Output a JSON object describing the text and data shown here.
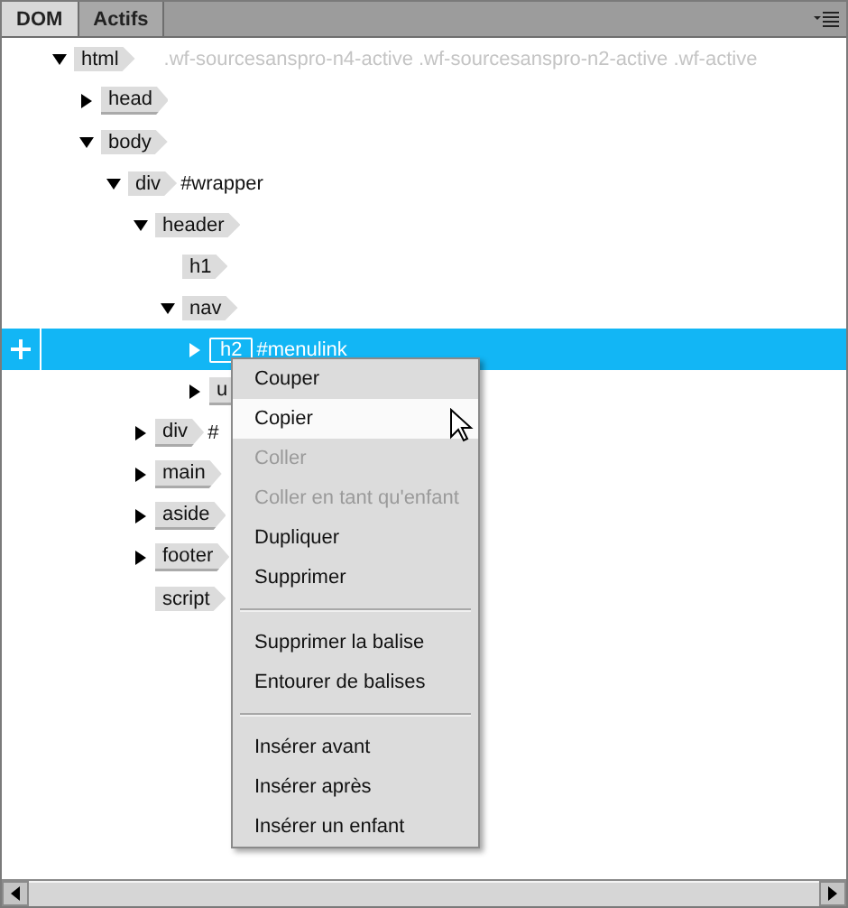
{
  "tabs": [
    {
      "label": "DOM",
      "selected": true
    },
    {
      "label": "Actifs",
      "selected": false
    }
  ],
  "tree": [
    {
      "tag": "html",
      "classes": ".wf-sourcesanspro-n4-active .wf-sourcesanspro-n2-active .wf-active",
      "expanded": true,
      "selected": false,
      "children": [
        {
          "tag": "head",
          "expanded": false,
          "selected": false
        },
        {
          "tag": "body",
          "expanded": true,
          "selected": false,
          "children": [
            {
              "tag": "div",
              "id": "#wrapper",
              "expanded": true,
              "selected": false,
              "children": [
                {
                  "tag": "header",
                  "expanded": true,
                  "selected": false,
                  "children": [
                    {
                      "tag": "h1",
                      "selected": false
                    },
                    {
                      "tag": "nav",
                      "expanded": true,
                      "selected": false,
                      "children": [
                        {
                          "tag": "h2",
                          "id": "#menulink",
                          "expanded": false,
                          "selected": true
                        },
                        {
                          "tag": "u",
                          "expanded": false,
                          "selected": false
                        }
                      ]
                    }
                  ]
                },
                {
                  "tag": "div",
                  "id": "#",
                  "expanded": false,
                  "selected": false
                },
                {
                  "tag": "main",
                  "expanded": false,
                  "selected": false
                },
                {
                  "tag": "aside",
                  "expanded": false,
                  "selected": false
                },
                {
                  "tag": "footer",
                  "expanded": false,
                  "selected": false
                },
                {
                  "tag": "script",
                  "selected": false
                }
              ]
            }
          ]
        }
      ]
    }
  ],
  "context_menu": [
    {
      "kind": "item",
      "label": "Couper",
      "disabled": false,
      "selected": false
    },
    {
      "kind": "item",
      "label": "Copier",
      "disabled": false,
      "selected": true
    },
    {
      "kind": "item",
      "label": "Coller",
      "disabled": true,
      "selected": false
    },
    {
      "kind": "item",
      "label": "Coller en tant qu'enfant",
      "disabled": true,
      "selected": false
    },
    {
      "kind": "item",
      "label": "Dupliquer",
      "disabled": false,
      "selected": false
    },
    {
      "kind": "item",
      "label": "Supprimer",
      "disabled": false,
      "selected": false
    },
    {
      "kind": "separator"
    },
    {
      "kind": "item",
      "label": "Supprimer la balise",
      "disabled": false,
      "selected": false
    },
    {
      "kind": "item",
      "label": "Entourer de balises",
      "disabled": false,
      "selected": false
    },
    {
      "kind": "separator"
    },
    {
      "kind": "item",
      "label": "Insérer avant",
      "disabled": false,
      "selected": false
    },
    {
      "kind": "item",
      "label": "Insérer après",
      "disabled": false,
      "selected": false
    },
    {
      "kind": "item",
      "label": "Insérer un enfant",
      "disabled": false,
      "selected": false
    }
  ]
}
